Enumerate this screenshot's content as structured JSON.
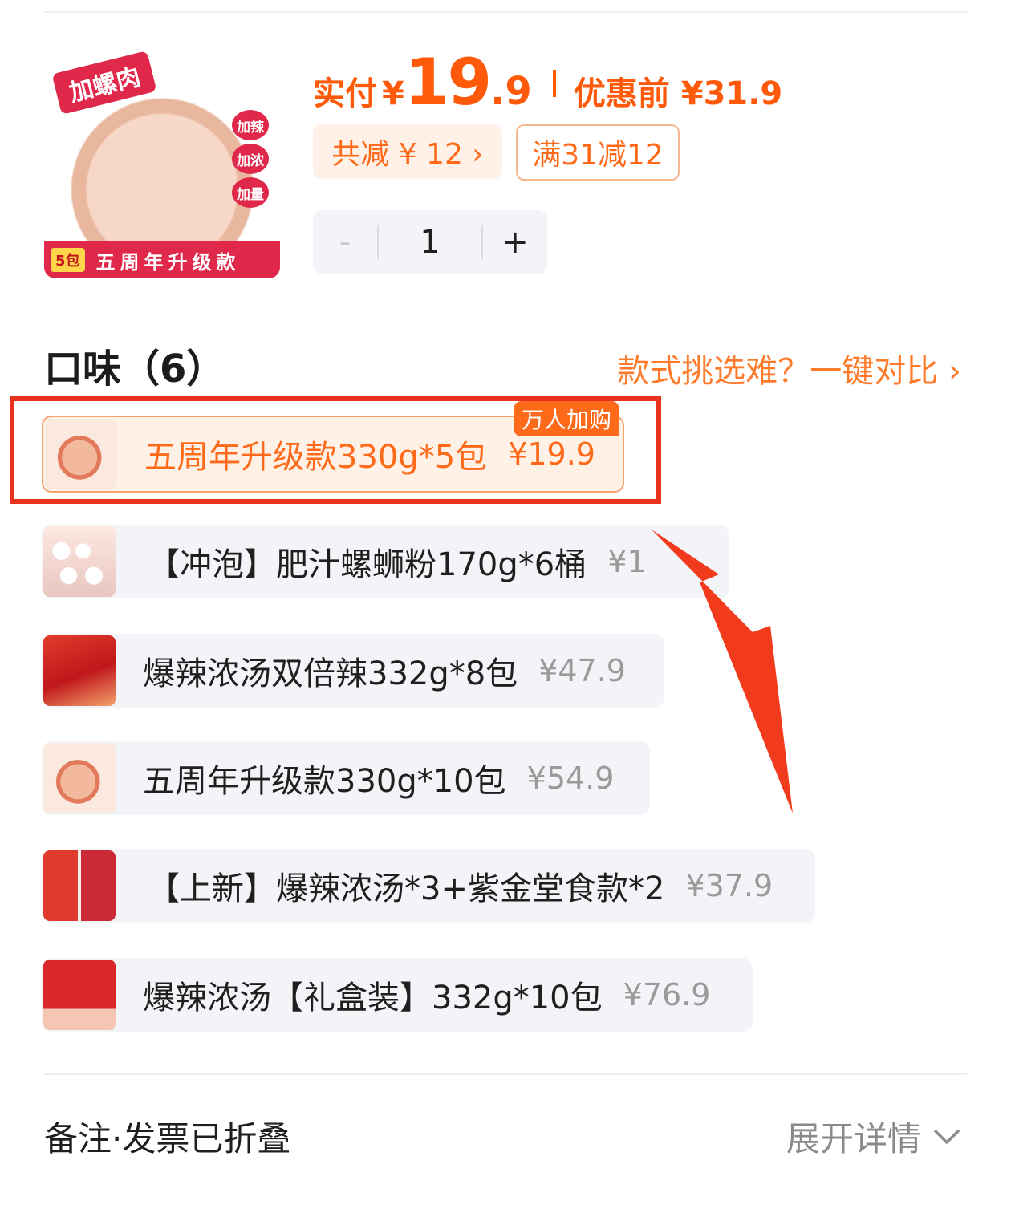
{
  "product": {
    "image_texts": {
      "ribbon": "加螺肉",
      "tags": [
        "加辣",
        "加浓",
        "加量"
      ],
      "badge": "5包",
      "banner": "五周年升级款"
    },
    "price_label": "实付",
    "currency": "¥",
    "price_int": "19",
    "price_dec": ".9",
    "original_price": "优惠前 ¥31.9",
    "discount_chip": "共减 ¥ 12 ›",
    "coupon_chip": "满31减12",
    "quantity": {
      "minus": "-",
      "value": "1",
      "plus": "+"
    }
  },
  "flavor": {
    "title": "口味（6）",
    "compare_link": "款式挑选难？一键对比 ›",
    "options": [
      {
        "name": "五周年升级款330g*5包",
        "price": "¥19.9",
        "tag": "万人加购",
        "selected": true,
        "img": "img-bowl"
      },
      {
        "name": "【冲泡】肥汁螺蛳粉170g*6桶",
        "price": "¥1",
        "selected": false,
        "img": "img-cups"
      },
      {
        "name": "爆辣浓汤双倍辣332g*8包",
        "price": "¥47.9",
        "selected": false,
        "img": "img-red"
      },
      {
        "name": "五周年升级款330g*10包",
        "price": "¥54.9",
        "selected": false,
        "img": "img-bowl"
      },
      {
        "name": "【上新】爆辣浓汤*3+紫金堂食款*2",
        "price": "¥37.9",
        "selected": false,
        "img": "img-bags"
      },
      {
        "name": "爆辣浓汤【礼盒装】332g*10包",
        "price": "¥76.9",
        "selected": false,
        "img": "img-gift"
      }
    ]
  },
  "footer": {
    "left": "备注·发票已折叠",
    "right": "展开详情"
  },
  "colors": {
    "accent": "#ff5a0a",
    "highlight": "#e8321f",
    "arrow": "#f23a1c"
  }
}
